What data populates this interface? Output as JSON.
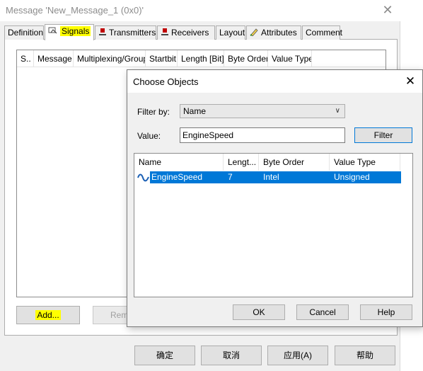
{
  "parent": {
    "title": "Message 'New_Message_1 (0x0)'",
    "tabs": [
      {
        "label": "Definition",
        "icon": "none"
      },
      {
        "label": "Signals",
        "icon": "signal-icon",
        "active": true,
        "highlighted": true
      },
      {
        "label": "Transmitters",
        "icon": "transmitter-icon"
      },
      {
        "label": "Receivers",
        "icon": "receiver-icon"
      },
      {
        "label": "Layout",
        "icon": "none"
      },
      {
        "label": "Attributes",
        "icon": "attributes-icon"
      },
      {
        "label": "Comment",
        "icon": "none"
      }
    ],
    "signal_columns": [
      "S..",
      "Message",
      "Multiplexing/Group",
      "Startbit",
      "Length [Bit]",
      "Byte Order",
      "Value Type"
    ],
    "add_button": "Add...",
    "remove_button": "Rem",
    "footer": {
      "ok": "确定",
      "cancel": "取消",
      "apply": "应用(A)",
      "help": "帮助"
    }
  },
  "dialog": {
    "title": "Choose Objects",
    "filter_by_label": "Filter by:",
    "filter_by_value": "Name",
    "value_label": "Value:",
    "value_input": "EngineSpeed",
    "filter_button": "Filter",
    "columns": [
      "Name",
      "Lengt...",
      "Byte Order",
      "Value Type"
    ],
    "rows": [
      {
        "name": "EngineSpeed",
        "length": "7",
        "byte_order": "Intel",
        "value_type": "Unsigned",
        "selected": true,
        "icon": "signal-wave-icon"
      }
    ],
    "ok_button": "OK",
    "cancel_button": "Cancel",
    "help_button": "Help"
  },
  "colors": {
    "highlight": "#ffff00",
    "selection": "#0078d7",
    "dialog_bg": "#f0f0f0",
    "transmitter_red": "#c00000"
  }
}
